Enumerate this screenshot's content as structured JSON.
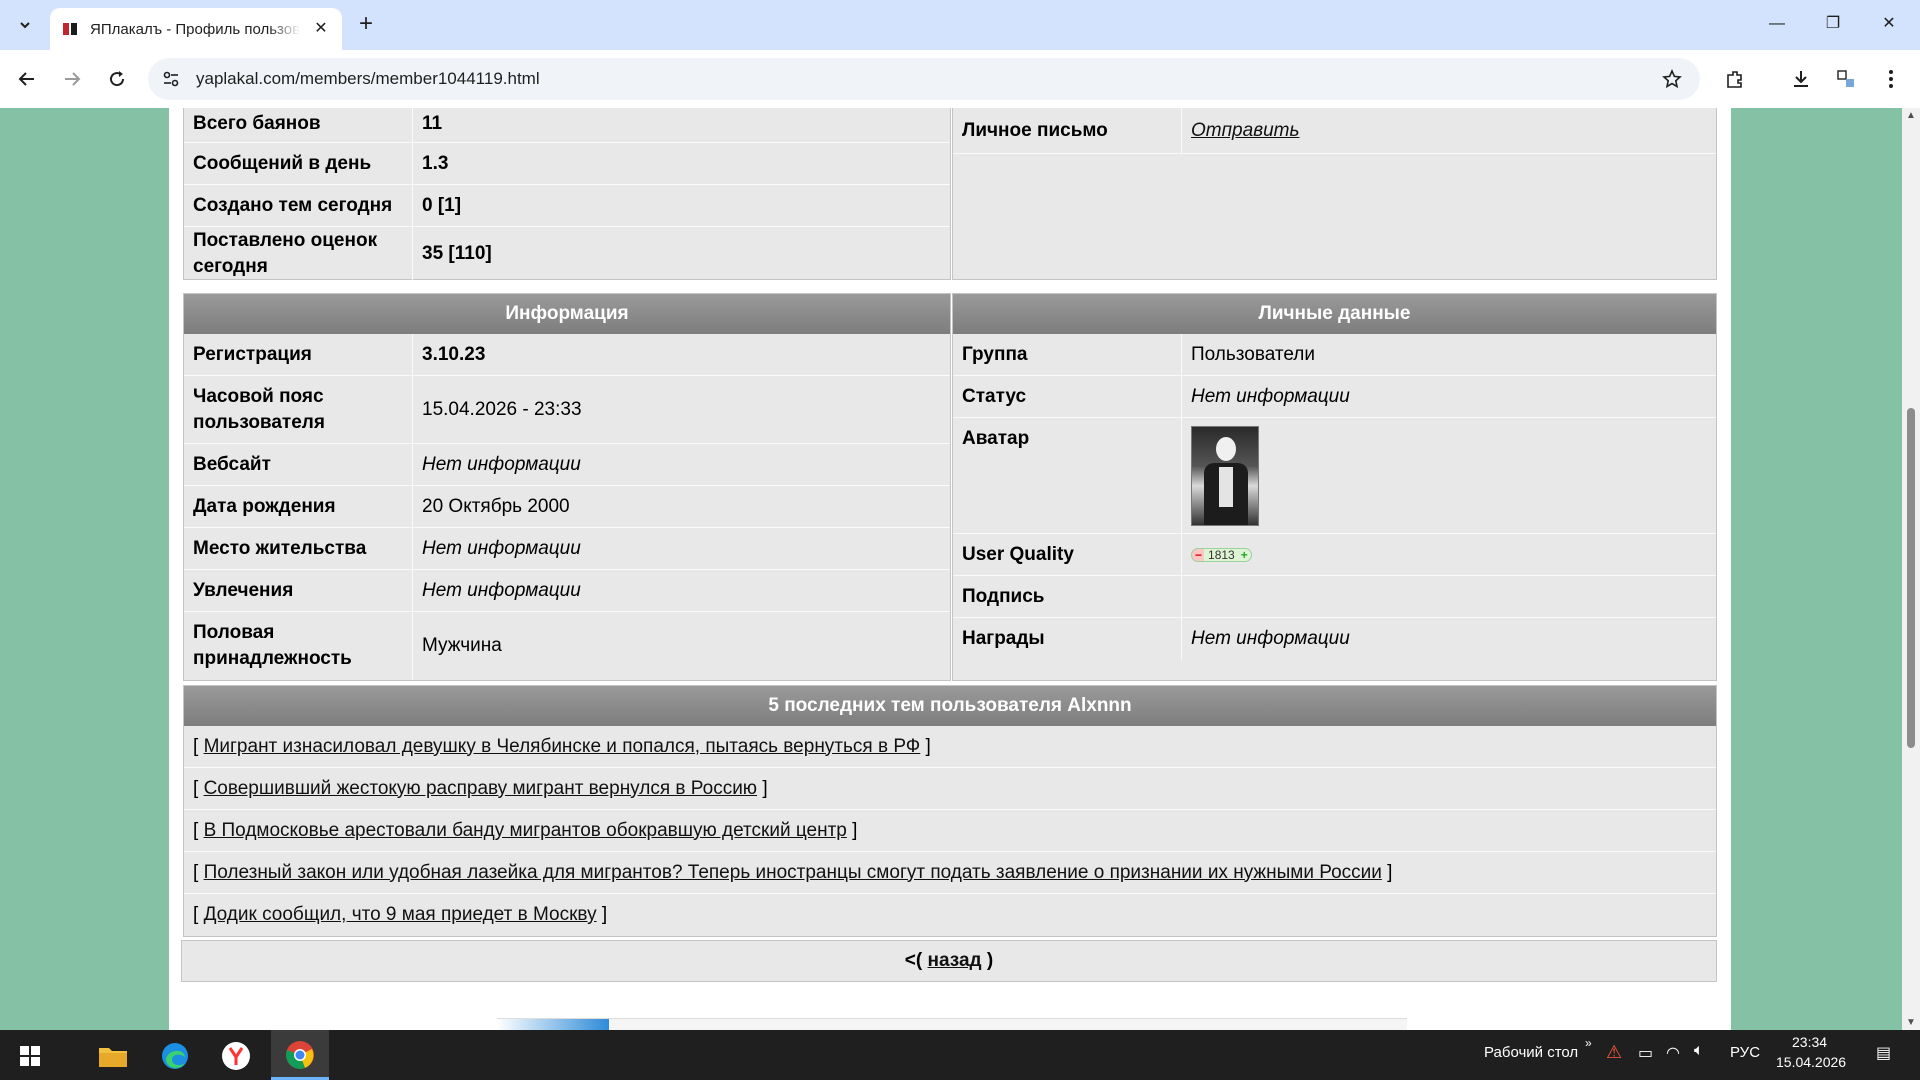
{
  "browser": {
    "tab_title": "ЯПлакалъ - Профиль пользователя",
    "url": "yaplakal.com/members/member1044119.html"
  },
  "stats": {
    "rows": [
      {
        "label": "Всего баянов",
        "value": "11"
      },
      {
        "label": "Сообщений в день",
        "value": "1.3"
      },
      {
        "label": "Создано тем сегодня",
        "value": "0 [1]"
      },
      {
        "label": "Поставлено оценок сегодня",
        "value": "35 [110]"
      }
    ]
  },
  "contact": {
    "label": "Личное письмо",
    "link": "Отправить"
  },
  "info": {
    "header": "Информация",
    "rows": [
      {
        "label": "Регистрация",
        "value": "3.10.23"
      },
      {
        "label": "Часовой пояс пользователя",
        "value": "15.04.2026 - 23:33"
      },
      {
        "label": "Вебсайт",
        "value": "Нет информации"
      },
      {
        "label": "Дата рождения",
        "value": "20 Октябрь 2000"
      },
      {
        "label": "Место жительства",
        "value": "Нет информации"
      },
      {
        "label": "Увлечения",
        "value": "Нет информации"
      },
      {
        "label": "Половая принадлежность",
        "value": "Мужчина"
      }
    ]
  },
  "personal": {
    "header": "Личные данные",
    "group_label": "Группа",
    "group_value": "Пользователи",
    "status_label": "Статус",
    "status_value": "Нет информации",
    "avatar_label": "Аватар",
    "quality_label": "User Quality",
    "quality_value": "1813",
    "signature_label": "Подпись",
    "awards_label": "Награды",
    "awards_value": "Нет информации"
  },
  "topics": {
    "header": "5 последних тем пользователя Alxnnn",
    "items": [
      "Мигрант изнасиловал девушку в Челябинске и попался, пытаясь вернуться в РФ",
      "Совершивший жестокую расправу мигрант вернулся в Россию",
      "В Подмосковье арестовали банду мигрантов обокравшую детский центр",
      "Полезный закон или удобная лазейка для мигрантов? Теперь иностранцы смогут подать заявление о признании их нужными России",
      "Додик сообщил, что 9 мая приедет в Москву"
    ],
    "bracket_open": "[",
    "bracket_close": "]"
  },
  "back": {
    "prefix": "<(",
    "link": "назад",
    "suffix": ")"
  },
  "taskbar": {
    "desktop_label": "Рабочий стол",
    "lang": "РУС",
    "time": "23:34",
    "date": "15.04.2026"
  }
}
